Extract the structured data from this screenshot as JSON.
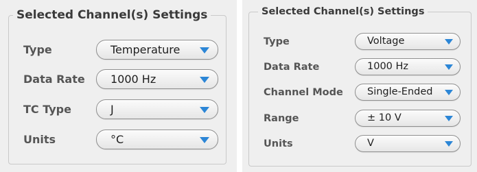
{
  "left_panel": {
    "legend": "Selected Channel(s) Settings",
    "rows": [
      {
        "label": "Type",
        "value": "Temperature"
      },
      {
        "label": "Data Rate",
        "value": "1000 Hz"
      },
      {
        "label": "TC Type",
        "value": "J"
      },
      {
        "label": "Units",
        "value": "°C"
      }
    ]
  },
  "right_panel": {
    "legend": "Selected Channel(s) Settings",
    "rows": [
      {
        "label": "Type",
        "value": "Voltage"
      },
      {
        "label": "Data Rate",
        "value": "1000 Hz"
      },
      {
        "label": "Channel Mode",
        "value": "Single-Ended"
      },
      {
        "label": "Range",
        "value": "± 10 V"
      },
      {
        "label": "Units",
        "value": "V"
      }
    ]
  },
  "colors": {
    "panel_background": "#efefef",
    "label_text": "#555555",
    "dropdown_arrow": "#2c86d6",
    "dropdown_border": "#8f8f8f"
  },
  "icons": {
    "dropdown_arrow": "chevron-down-icon"
  }
}
